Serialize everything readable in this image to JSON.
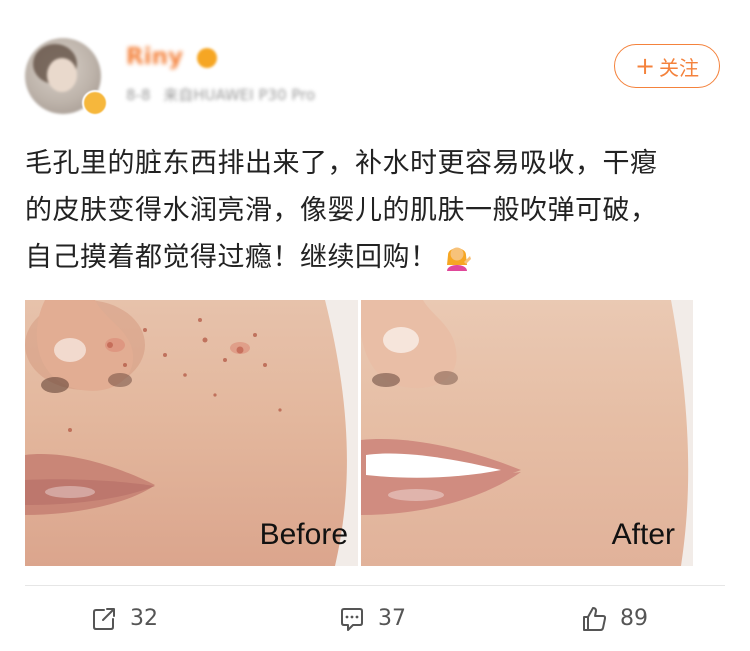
{
  "user": {
    "name": "Riny",
    "meta_time": "8-8",
    "meta_source": "来自HUAWEI P30 Pro",
    "follow_label": "关注",
    "avatar_icon": "avatar",
    "badge_icon": "vip-badge-icon"
  },
  "post": {
    "lines": [
      "毛孔里的脏东西排出来了，补水时更容易吸收，干瘪",
      "的皮肤变得水润亮滑，像婴儿的肌肤一般吹弹可破，",
      "自己摸着都觉得过瘾！继续回购！"
    ],
    "emoji_icon": "woman-tipping-hand-emoji"
  },
  "photos": {
    "before_label": "Before",
    "after_label": "After"
  },
  "actions": {
    "share_count": "32",
    "comment_count": "37",
    "like_count": "89"
  },
  "colors": {
    "accent": "#f4823c",
    "text": "#222222",
    "muted": "#9a9a9a"
  }
}
